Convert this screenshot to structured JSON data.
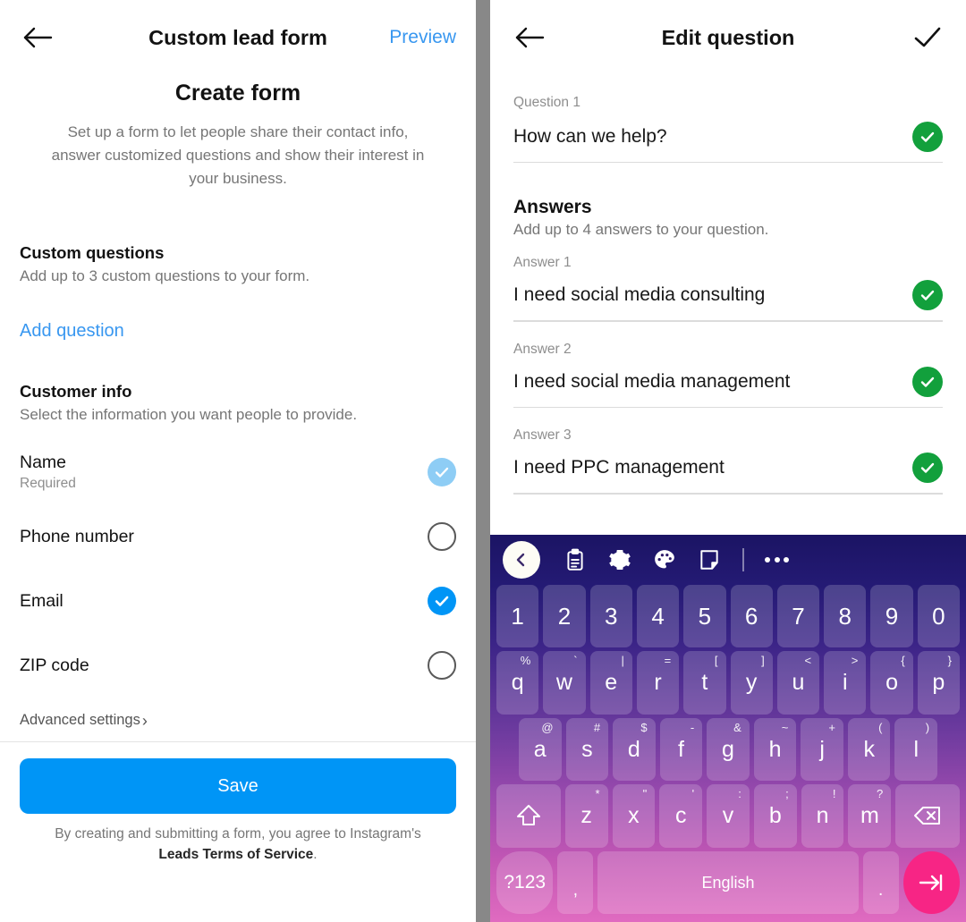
{
  "left": {
    "nav": {
      "title": "Custom lead form",
      "preview_label": "Preview",
      "back_icon": "arrow-left-icon"
    },
    "heading": "Create form",
    "description": "Set up a form to let people share their contact info, answer customized questions and show their interest in your business.",
    "custom_questions": {
      "title": "Custom questions",
      "subtitle": "Add up to 3 custom questions to your form.",
      "add_label": "Add question"
    },
    "customer_info": {
      "title": "Customer info",
      "subtitle": "Select the information you want people to provide.",
      "rows": [
        {
          "label": "Name",
          "sub": "Required",
          "state": "checked-disabled"
        },
        {
          "label": "Phone number",
          "sub": "",
          "state": "unchecked"
        },
        {
          "label": "Email",
          "sub": "",
          "state": "checked"
        },
        {
          "label": "ZIP code",
          "sub": "",
          "state": "unchecked"
        }
      ]
    },
    "advanced_settings": "Advanced settings",
    "save_label": "Save",
    "legal_prefix": "By creating and submitting a form, you agree to Instagram's ",
    "legal_link": "Leads Terms of Service",
    "legal_suffix": "."
  },
  "right": {
    "nav": {
      "title": "Edit question",
      "back_icon": "arrow-left-icon",
      "confirm_icon": "check-icon"
    },
    "question": {
      "label": "Question 1",
      "value": "How can we help?"
    },
    "answers": {
      "title": "Answers",
      "subtitle": "Add up to 4 answers to your question.",
      "items": [
        {
          "label": "Answer 1",
          "value": "I need social media consulting"
        },
        {
          "label": "Answer 2",
          "value": "I need social media management"
        },
        {
          "label": "Answer 3",
          "value": "I need PPC management"
        }
      ]
    }
  },
  "keyboard": {
    "toolbar": [
      "back-circle-icon",
      "clipboard-icon",
      "gear-icon",
      "palette-icon",
      "resize-icon",
      "divider",
      "more-icon"
    ],
    "row_numbers": [
      {
        "main": "1"
      },
      {
        "main": "2"
      },
      {
        "main": "3"
      },
      {
        "main": "4"
      },
      {
        "main": "5"
      },
      {
        "main": "6"
      },
      {
        "main": "7"
      },
      {
        "main": "8"
      },
      {
        "main": "9"
      },
      {
        "main": "0"
      }
    ],
    "row_top": [
      {
        "main": "q",
        "sup": "%"
      },
      {
        "main": "w",
        "sup": "`"
      },
      {
        "main": "e",
        "sup": "|"
      },
      {
        "main": "r",
        "sup": "="
      },
      {
        "main": "t",
        "sup": "["
      },
      {
        "main": "y",
        "sup": "]"
      },
      {
        "main": "u",
        "sup": "<"
      },
      {
        "main": "i",
        "sup": ">"
      },
      {
        "main": "o",
        "sup": "{"
      },
      {
        "main": "p",
        "sup": "}"
      }
    ],
    "row_home": [
      {
        "main": "a",
        "sup": "@"
      },
      {
        "main": "s",
        "sup": "#"
      },
      {
        "main": "d",
        "sup": "$"
      },
      {
        "main": "f",
        "sup": "-"
      },
      {
        "main": "g",
        "sup": "&"
      },
      {
        "main": "h",
        "sup": "~"
      },
      {
        "main": "j",
        "sup": "+"
      },
      {
        "main": "k",
        "sup": "("
      },
      {
        "main": "l",
        "sup": ")"
      }
    ],
    "row_bottom": [
      {
        "main": "z",
        "sup": "*"
      },
      {
        "main": "x",
        "sup": "\""
      },
      {
        "main": "c",
        "sup": "'"
      },
      {
        "main": "v",
        "sup": ":"
      },
      {
        "main": "b",
        "sup": ";"
      },
      {
        "main": "n",
        "sup": "!"
      },
      {
        "main": "m",
        "sup": "?"
      }
    ],
    "shift_icon": "shift-icon",
    "backspace_icon": "backspace-icon",
    "symbols_key": "?123",
    "comma_key": ",",
    "space_key": "English",
    "period_key": ".",
    "enter_icon": "enter-icon"
  },
  "colors": {
    "accent_blue": "#0095f6",
    "link_blue": "#3897f0",
    "checkbox_dim": "#8ecdf5",
    "green": "#12a03c",
    "enter_pink": "#f72585"
  }
}
